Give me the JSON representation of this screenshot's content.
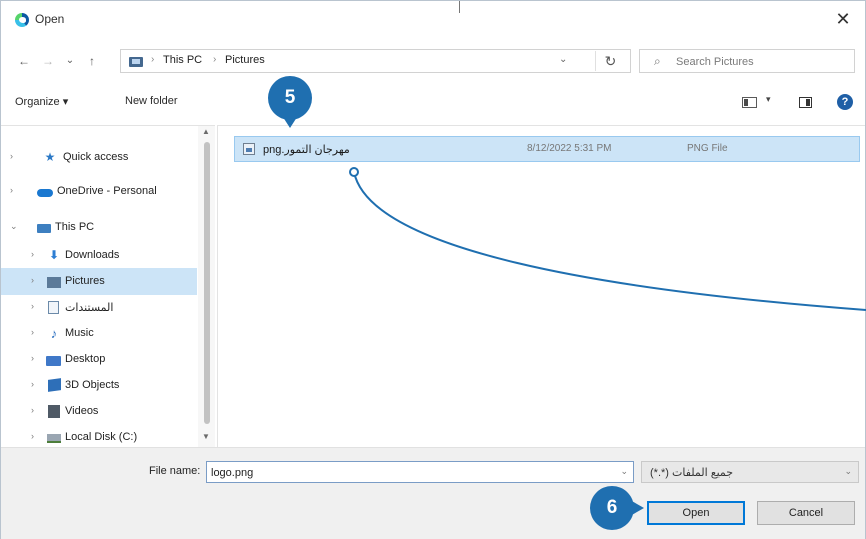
{
  "dialog": {
    "title": "Open",
    "close_glyph": "✕",
    "app_icon": "edge-browser-icon"
  },
  "address": {
    "back_glyph": "←",
    "forward_glyph": "→",
    "recent_glyph": "⌄",
    "up_glyph": "↑",
    "breadcrumbs": [
      "This PC",
      "Pictures"
    ],
    "separator": "›",
    "dropdown_glyph": "⌄",
    "refresh_glyph": "↻"
  },
  "search": {
    "icon": "search-icon",
    "glyph": "⌕",
    "placeholder": "Search Pictures"
  },
  "commands": {
    "organize": "Organize ▾",
    "new_folder": "New folder",
    "view_dropdown": "▾",
    "help": "?"
  },
  "nav": {
    "items": [
      {
        "label": "Quick access",
        "icon": "star-icon",
        "chevron": "›"
      },
      {
        "label": "OneDrive - Personal",
        "icon": "cloud-icon",
        "chevron": "›"
      },
      {
        "label": "This PC",
        "icon": "computer-icon",
        "chevron": "⌄"
      },
      {
        "label": "Downloads",
        "icon": "download-icon",
        "chevron": "›"
      },
      {
        "label": "Pictures",
        "icon": "pictures-icon",
        "chevron": "›"
      },
      {
        "label": "المستندات",
        "icon": "documents-icon",
        "chevron": "›"
      },
      {
        "label": "Music",
        "icon": "music-icon",
        "chevron": "›"
      },
      {
        "label": "Desktop",
        "icon": "desktop-icon",
        "chevron": "›"
      },
      {
        "label": "3D Objects",
        "icon": "cube-icon",
        "chevron": "›"
      },
      {
        "label": "Videos",
        "icon": "video-icon",
        "chevron": "›"
      },
      {
        "label": "Local Disk (C:)",
        "icon": "disk-icon",
        "chevron": "›"
      }
    ],
    "scroll_up": "▲",
    "scroll_down": "▼"
  },
  "files": [
    {
      "name": "مهرجان التمور.png",
      "date": "8/12/2022 5:31 PM",
      "type": "PNG File",
      "icon": "image-file-icon",
      "selected": true
    }
  ],
  "bottom": {
    "file_name_label": "File name:",
    "file_name_value": "logo.png",
    "file_name_dropdown": "⌄",
    "filter": "جميع الملفات (*.*)",
    "filter_dropdown": "⌄",
    "open_label": "Open",
    "cancel_label": "Cancel"
  },
  "annotations": {
    "step5": "5",
    "step6": "6",
    "color": "#1f6fb0"
  }
}
